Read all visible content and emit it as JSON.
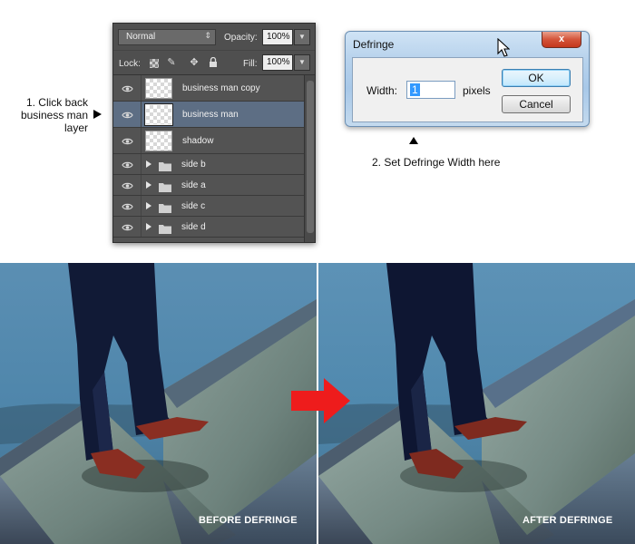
{
  "annotations": {
    "step1_lines": [
      "1. Click back",
      "business man",
      "layer"
    ],
    "step2": "2. Set Defringe Width here"
  },
  "layers_panel": {
    "blend_mode": "Normal",
    "opacity_label": "Opacity:",
    "opacity_value": "100%",
    "lock_label": "Lock:",
    "fill_label": "Fill:",
    "fill_value": "100%",
    "layers": [
      {
        "name": "business man copy",
        "type": "layer",
        "selected": false
      },
      {
        "name": "business man",
        "type": "layer",
        "selected": true
      },
      {
        "name": "shadow",
        "type": "layer",
        "selected": false
      },
      {
        "name": "side b",
        "type": "folder",
        "selected": false
      },
      {
        "name": "side a",
        "type": "folder",
        "selected": false
      },
      {
        "name": "side c",
        "type": "folder",
        "selected": false
      },
      {
        "name": "side d",
        "type": "folder",
        "selected": false
      }
    ]
  },
  "dialog": {
    "title": "Defringe",
    "close_glyph": "x",
    "width_label": "Width:",
    "width_value": "1",
    "unit_label": "pixels",
    "ok_label": "OK",
    "cancel_label": "Cancel"
  },
  "photos": {
    "before_caption": "BEFORE DEFRINGE",
    "after_caption": "AFTER DEFRINGE"
  },
  "colors": {
    "panel_bg": "#535353",
    "selected_layer": "#5d6e84",
    "arrow_red": "#ee1c1c",
    "close_button": "#c4371d"
  },
  "icons": [
    "eye-icon",
    "folder-icon",
    "expand-triangle-icon",
    "lock-transparent-icon",
    "lock-paint-icon",
    "lock-move-icon",
    "lock-all-icon",
    "dropdown-arrow-icon",
    "mouse-cursor-icon",
    "red-right-arrow-icon",
    "left-arrow-icon",
    "up-arrow-icon"
  ]
}
